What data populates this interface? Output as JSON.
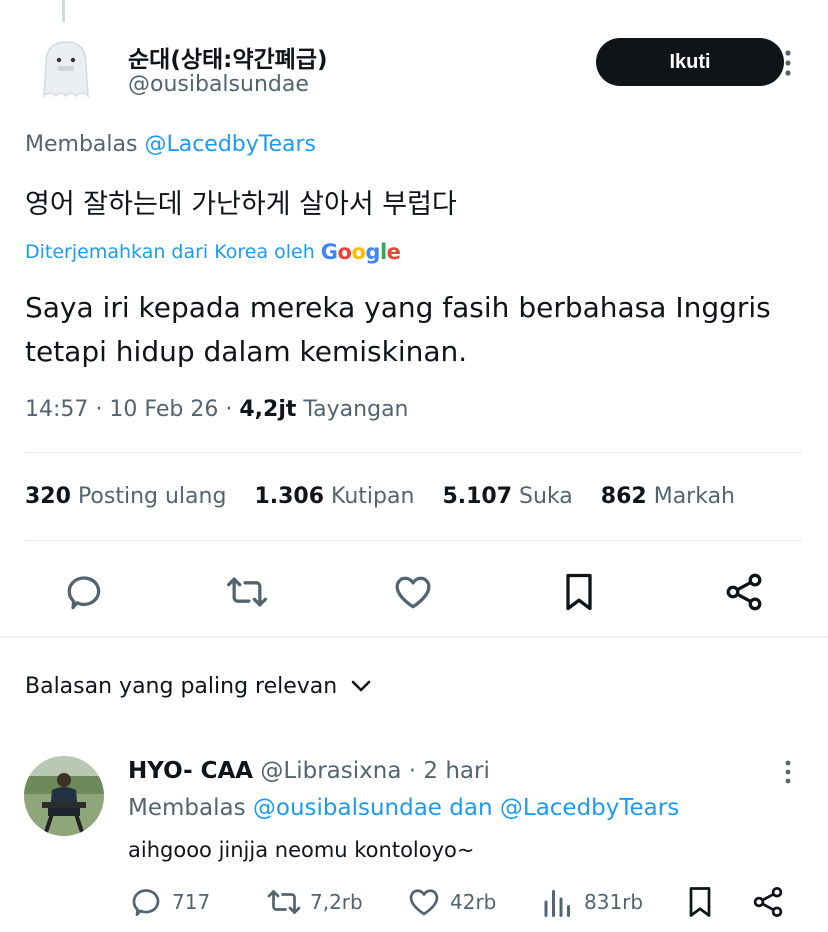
{
  "tweet": {
    "display_name": "순대(상태:약간폐급)",
    "handle": "@ousibalsundae",
    "follow_label": "Ikuti",
    "replying_prefix": "Membalas",
    "replying_to": "@LacedbyTears",
    "original_text": "영어 잘하는데 가난하게 살아서 부럽다",
    "translated_by": "Diterjemahkan dari Korea oleh",
    "translation_provider": "Google",
    "translated_text": "Saya iri kepada mereka yang fasih berbahasa Inggris tetapi hidup dalam kemiskinan.",
    "time": "14:57",
    "date": "10 Feb 26",
    "views_count": "4,2jt",
    "views_label": "Tayangan",
    "stats": [
      {
        "count": "320",
        "label": "Posting ulang"
      },
      {
        "count": "1.306",
        "label": "Kutipan"
      },
      {
        "count": "5.107",
        "label": "Suka"
      },
      {
        "count": "862",
        "label": "Markah"
      }
    ],
    "actions": [
      "reply-icon",
      "retweet-icon",
      "like-icon",
      "bookmark-icon",
      "share-icon"
    ]
  },
  "sort_label": "Balasan yang paling relevan",
  "reply": {
    "display_name": "HYO- CAA",
    "handle": "@Librasixna",
    "time_ago": "2 hari",
    "replying_prefix": "Membalas",
    "replying_to_1": "@ousibalsundae",
    "replying_and": "dan",
    "replying_to_2": "@LacedbyTears",
    "text": "aihgooo jinjja neomu kontoloyo~",
    "reply_count": "717",
    "retweet_count": "7,2rb",
    "like_count": "42rb",
    "views_count": "831rb"
  },
  "colors": {
    "link": "#1d9bf0",
    "muted": "#536471",
    "text": "#0f1419",
    "follow_bg": "#0f1419"
  }
}
